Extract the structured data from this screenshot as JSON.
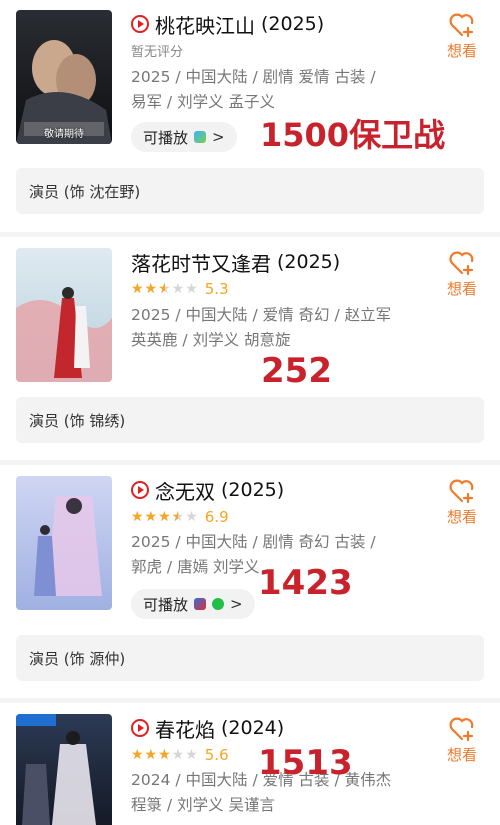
{
  "accent": "#e02020",
  "want_color": "#f07a2a",
  "star_color": "#f5a623",
  "overlay_color": "#c8232c",
  "items": [
    {
      "title": "桃花映江山",
      "year": "(2025)",
      "has_play_icon": true,
      "rating_label": "暂无评分",
      "stars": null,
      "info_line1": "2025 / 中国大陆 / 剧情 爱情 古装 /",
      "info_line2": "易军 / 刘学义 孟子义",
      "playable_label": "可播放",
      "playable_chevron": ">",
      "want_label": "想看",
      "cast": "演员 (饰 沈在野)",
      "poster_caption": "敬请期待",
      "overlay": "1500保卫战"
    },
    {
      "title": "落花时节又逢君",
      "year": "(2025)",
      "has_play_icon": false,
      "rating": "5.3",
      "stars": 2.5,
      "info_line1": "2025 / 中国大陆 / 爱情 奇幻 / 赵立军",
      "info_line2": "英英鹿 / 刘学义 胡意旋",
      "want_label": "想看",
      "cast": "演员 (饰 锦绣)",
      "overlay": "252"
    },
    {
      "title": "念无双",
      "year": "(2025)",
      "has_play_icon": true,
      "rating": "6.9",
      "stars": 3.5,
      "info_line1": "2025 / 中国大陆 / 剧情 奇幻 古装 /",
      "info_line2": "郭虎 / 唐嫣 刘学义",
      "playable_label": "可播放",
      "playable_chevron": ">",
      "want_label": "想看",
      "cast": "演员 (饰 源仲)",
      "overlay": "1423"
    },
    {
      "title": "春花焰",
      "year": "(2024)",
      "has_play_icon": true,
      "rating": "5.6",
      "stars": 3,
      "info_line1": "2024 / 中国大陆 / 爱情 古装 / 黄伟杰",
      "info_line2": "程箓 / 刘学义 吴谨言",
      "want_label": "想看",
      "overlay": "1513"
    }
  ]
}
